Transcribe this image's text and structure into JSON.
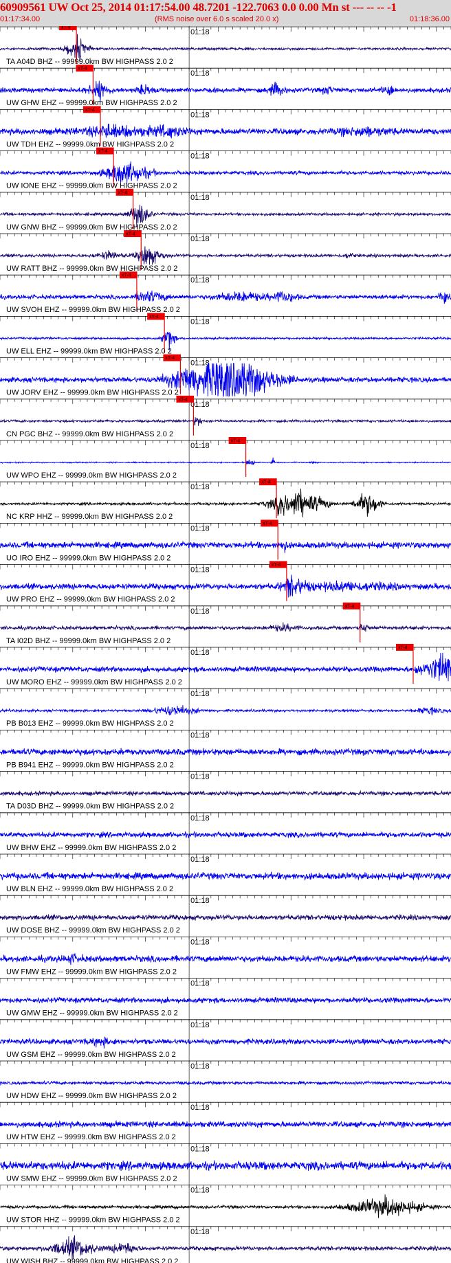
{
  "header": {
    "title": "60909561 UW Oct 25, 2014 01:17:54.00   48.7201 -122.7063  0.0 0.00 Mn st --- -- --  -1",
    "start_time": "01:17:34.00",
    "scale_note": "(RMS noise over 6.0 s scaled 20.0 x)",
    "end_time": "01:18:36.00"
  },
  "chart_data": {
    "type": "seismogram",
    "time_range": [
      "01:17:34.00",
      "01:18:36.00"
    ],
    "minute_mark_label": "01:18",
    "minute_mark_offset_s": 26,
    "pick_label": "xT-4",
    "colors": {
      "blue": "#0000ee",
      "navy": "#1a0a6e",
      "black": "#000000",
      "pick": "#ee0000",
      "header_bg": "#d8d8d8"
    },
    "traces": [
      {
        "label": "TA A04D BHZ -- 99999.0km BW  HIGHPASS  2.0  2",
        "color": "navy",
        "pick_s": 10.5,
        "noise": 0.12,
        "bursts": [
          [
            10.5,
            2.5,
            0.9
          ]
        ]
      },
      {
        "label": "UW GHW EHZ -- 99999.0km BW  HIGHPASS  2.0  2",
        "color": "blue",
        "pick_s": 12.8,
        "noise": 0.22,
        "bursts": [
          [
            13.5,
            3.0,
            0.5
          ],
          [
            20.0,
            2.0,
            0.4
          ],
          [
            38.0,
            2.0,
            0.6
          ],
          [
            45.0,
            1.5,
            0.3
          ],
          [
            53.5,
            1.5,
            0.45
          ]
        ]
      },
      {
        "label": "UW TDH EHZ -- 99999.0km BW  HIGHPASS  2.0  2",
        "color": "blue",
        "pick_s": 13.8,
        "noise": 0.3,
        "bursts": [
          [
            16.0,
            8.0,
            0.4
          ],
          [
            23.0,
            4.0,
            0.45
          ],
          [
            50.0,
            6.0,
            0.3
          ]
        ]
      },
      {
        "label": "UW IONE EHZ -- 99999.0km BW  HIGHPASS  2.0  2",
        "color": "blue",
        "pick_s": 15.6,
        "noise": 0.18,
        "bursts": [
          [
            17.5,
            5.0,
            1.0
          ]
        ]
      },
      {
        "label": "UW GNW BHZ -- 99999.0km BW  HIGHPASS  2.0  2",
        "color": "navy",
        "pick_s": 18.3,
        "noise": 0.14,
        "bursts": [
          [
            19.2,
            2.5,
            0.95
          ]
        ]
      },
      {
        "label": "UW RATT BHZ -- 99999.0km BW  HIGHPASS  2.0  2",
        "color": "navy",
        "pick_s": 19.4,
        "noise": 0.15,
        "bursts": [
          [
            20.5,
            3.0,
            0.8
          ],
          [
            15.0,
            3.0,
            0.35
          ],
          [
            48.0,
            1.0,
            0.25
          ]
        ]
      },
      {
        "label": "UW SVOH EHZ -- 99999.0km BW  HIGHPASS  2.0  2",
        "color": "blue",
        "pick_s": 18.8,
        "noise": 0.2,
        "bursts": [
          [
            21.0,
            3.0,
            0.5
          ],
          [
            33.0,
            6.0,
            0.4
          ],
          [
            39.0,
            3.0,
            0.5
          ],
          [
            61.0,
            1.0,
            0.9
          ]
        ]
      },
      {
        "label": "UW ELL EHZ -- 99999.0km BW  HIGHPASS  2.0  2",
        "color": "blue",
        "pick_s": 22.6,
        "noise": 0.1,
        "bursts": [
          [
            23.2,
            1.5,
            0.75
          ]
        ]
      },
      {
        "label": "UW JORV EHZ -- 99999.0km BW  HIGHPASS  2.0  2",
        "color": "blue",
        "pick_s": 24.8,
        "noise": 0.25,
        "bursts": [
          [
            31.0,
            11.0,
            2.4
          ]
        ]
      },
      {
        "label": "CN PGC BHZ -- 99999.0km BW  HIGHPASS  2.0  2",
        "color": "navy",
        "pick_s": 26.6,
        "noise": 0.12,
        "bursts": []
      },
      {
        "label": "UW WPO EHZ -- 99999.0km BW  HIGHPASS  2.0  2",
        "color": "blue",
        "pick_s": 33.8,
        "noise": 0.06,
        "bursts": [
          [
            37.5,
            0.4,
            0.5
          ],
          [
            43.0,
            0.3,
            0.2
          ]
        ]
      },
      {
        "label": "NC KRP HHZ -- 99999.0km BW  HIGHPASS  2.0  2",
        "color": "black",
        "pick_s": 38.0,
        "noise": 0.12,
        "bursts": [
          [
            41.0,
            6.0,
            1.3
          ],
          [
            50.5,
            3.0,
            1.1
          ]
        ]
      },
      {
        "label": "UO IRO EHZ -- 99999.0km BW  HIGHPASS  2.0  2",
        "color": "blue",
        "pick_s": 38.2,
        "noise": 0.3,
        "bursts": []
      },
      {
        "label": "UW PRO EHZ -- 99999.0km BW  HIGHPASS  2.0  2",
        "color": "blue",
        "pick_s": 39.4,
        "noise": 0.28,
        "bursts": [
          [
            40.5,
            3.0,
            0.7
          ],
          [
            48.0,
            10.0,
            0.3
          ]
        ]
      },
      {
        "label": "TA I02D BHZ -- 99999.0km BW  HIGHPASS  2.0  2",
        "color": "navy",
        "pick_s": 49.5,
        "noise": 0.18,
        "bursts": [
          [
            39.0,
            3.0,
            0.3
          ]
        ]
      },
      {
        "label": "UW MORO EHZ -- 99999.0km BW  HIGHPASS  2.0  2",
        "color": "blue",
        "pick_s": 56.8,
        "noise": 0.25,
        "bursts": [
          [
            61.0,
            4.0,
            1.6
          ]
        ]
      },
      {
        "label": "PB B013 EHZ -- 99999.0km BW  HIGHPASS  2.0  2",
        "color": "blue",
        "pick_s": null,
        "noise": 0.12,
        "bursts": [
          [
            24.0,
            5.0,
            0.5
          ],
          [
            59.0,
            3.0,
            0.3
          ]
        ]
      },
      {
        "label": "PB B941 EHZ -- 99999.0km BW  HIGHPASS  2.0  2",
        "color": "blue",
        "pick_s": null,
        "noise": 0.3,
        "bursts": []
      },
      {
        "label": "TA D03D BHZ -- 99999.0km BW  HIGHPASS  2.0  2",
        "color": "navy",
        "pick_s": null,
        "noise": 0.2,
        "bursts": []
      },
      {
        "label": "UW BHW EHZ -- 99999.0km BW  HIGHPASS  2.0  2",
        "color": "blue",
        "pick_s": null,
        "noise": 0.25,
        "bursts": []
      },
      {
        "label": "UW BLN EHZ -- 99999.0km BW  HIGHPASS  2.0  2",
        "color": "blue",
        "pick_s": null,
        "noise": 0.32,
        "bursts": []
      },
      {
        "label": "UW DOSE BHZ -- 99999.0km BW  HIGHPASS  2.0  2",
        "color": "navy",
        "pick_s": null,
        "noise": 0.25,
        "bursts": []
      },
      {
        "label": "UW FMW EHZ -- 99999.0km BW  HIGHPASS  2.0  2",
        "color": "blue",
        "pick_s": null,
        "noise": 0.3,
        "bursts": [
          [
            10.0,
            2.0,
            0.3
          ]
        ]
      },
      {
        "label": "UW GMW EHZ -- 99999.0km BW  HIGHPASS  2.0  2",
        "color": "blue",
        "pick_s": null,
        "noise": 0.25,
        "bursts": []
      },
      {
        "label": "UW GSM EHZ -- 99999.0km BW  HIGHPASS  2.0  2",
        "color": "blue",
        "pick_s": null,
        "noise": 0.25,
        "bursts": [
          [
            14.0,
            3.0,
            0.3
          ]
        ]
      },
      {
        "label": "UW HDW EHZ -- 99999.0km BW  HIGHPASS  2.0  2",
        "color": "blue",
        "pick_s": null,
        "noise": 0.15,
        "bursts": []
      },
      {
        "label": "UW HTW EHZ -- 99999.0km BW  HIGHPASS  2.0  2",
        "color": "blue",
        "pick_s": null,
        "noise": 0.28,
        "bursts": []
      },
      {
        "label": "UW SMW EHZ -- 99999.0km BW  HIGHPASS  2.0  2",
        "color": "blue",
        "pick_s": null,
        "noise": 0.4,
        "bursts": []
      },
      {
        "label": "UW STOR HHZ -- 99999.0km BW  HIGHPASS  2.0  2",
        "color": "black",
        "pick_s": null,
        "noise": 0.15,
        "bursts": [
          [
            53.0,
            8.0,
            0.9
          ]
        ]
      },
      {
        "label": "UW WISH BHZ -- 99999.0km BW  HIGHPASS  2.0  2",
        "color": "navy",
        "pick_s": null,
        "noise": 0.2,
        "bursts": [
          [
            10.0,
            5.0,
            0.9
          ],
          [
            17.0,
            3.0,
            0.5
          ]
        ]
      }
    ]
  }
}
